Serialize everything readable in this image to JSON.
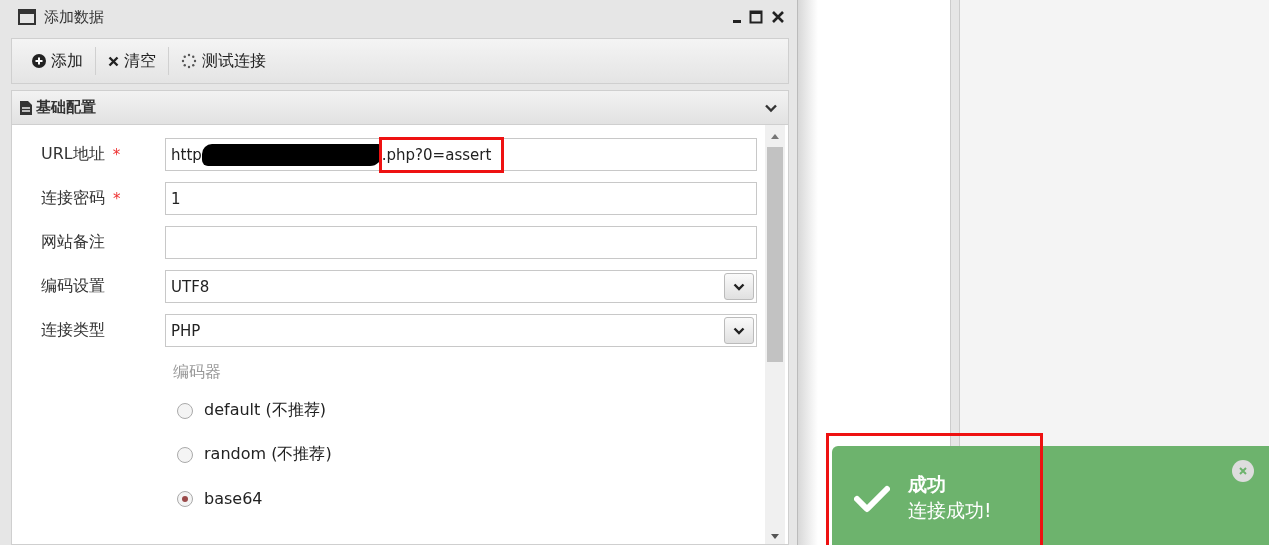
{
  "window": {
    "title": "添加数据"
  },
  "toolbar": [
    {
      "label": "添加",
      "kind": "add"
    },
    {
      "label": "清空",
      "kind": "clear"
    },
    {
      "label": "测试连接",
      "kind": "test"
    }
  ],
  "section": {
    "title": "基础配置",
    "expanded": true
  },
  "fields": [
    {
      "kind": "url",
      "label": "URL地址",
      "required_mark": "*",
      "value_start": "http",
      "value_end": ".php?0=assert"
    },
    {
      "kind": "input",
      "label": "连接密码",
      "required_mark": "*",
      "value": "1"
    },
    {
      "kind": "input",
      "label": "网站备注"
    },
    {
      "kind": "select",
      "label": "编码设置",
      "value": "UTF8"
    },
    {
      "kind": "select",
      "label": "连接类型",
      "value": "PHP"
    }
  ],
  "encoder": {
    "title": "编码器",
    "options": [
      {
        "label": "default (不推荐)",
        "selected": false
      },
      {
        "label": "random (不推荐)",
        "selected": false
      },
      {
        "label": "base64",
        "selected": true
      }
    ]
  },
  "toast": {
    "title": "成功",
    "message": "连接成功!"
  }
}
